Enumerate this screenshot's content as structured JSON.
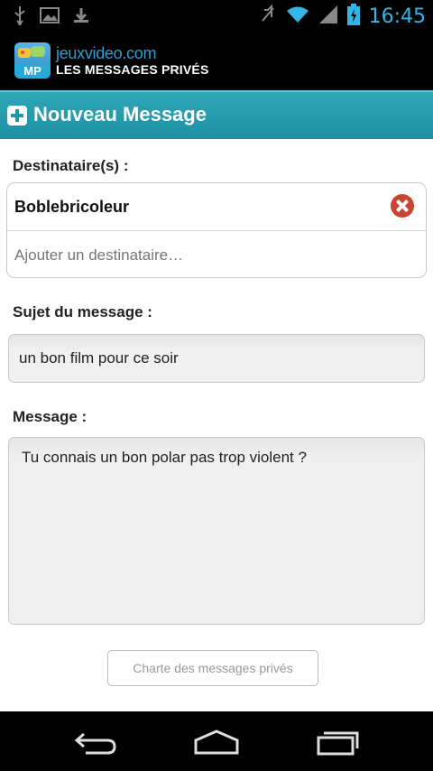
{
  "status_bar": {
    "time": "16:45",
    "icons": [
      "usb-icon",
      "image-icon",
      "download-icon",
      "mute-icon",
      "wifi-icon",
      "signal-icon",
      "battery-charging-icon"
    ]
  },
  "app_header": {
    "brand_name": "jeuxvideo",
    "brand_domain": ".com",
    "subtitle": "LES MESSAGES PRIVÉS",
    "logo_badge": "MP"
  },
  "title_bar": {
    "title": "Nouveau Message"
  },
  "form": {
    "recipients_label": "Destinataire(s) :",
    "recipients": [
      "Boblebricoleur"
    ],
    "add_recipient_placeholder": "Ajouter un destinataire…",
    "subject_label": "Sujet du message :",
    "subject_value": "un bon film pour ce soir",
    "message_label": "Message :",
    "message_value": "Tu connais un bon polar pas trop violent ?",
    "charte_button": "Charte des messages privés"
  },
  "nav_bar": {
    "buttons": [
      "back-icon",
      "home-icon",
      "recent-apps-icon"
    ]
  },
  "colors": {
    "accent": "#1d8fa3",
    "time": "#33b5e5",
    "remove": "#c9452f"
  }
}
